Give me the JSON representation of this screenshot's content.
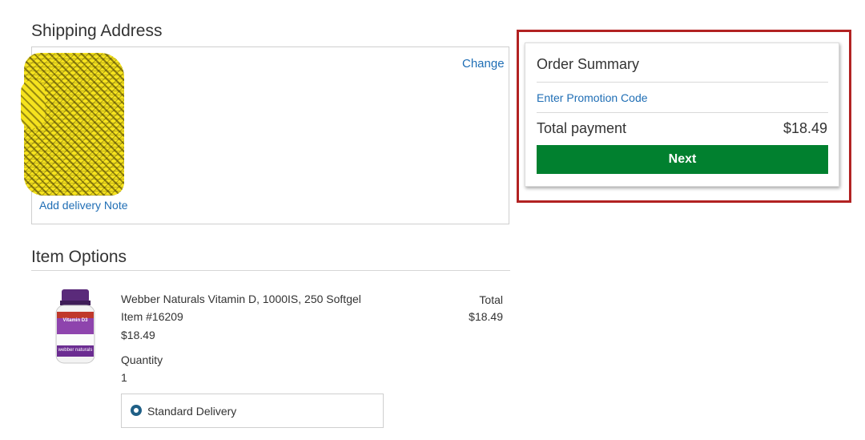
{
  "shipping": {
    "title": "Shipping Address",
    "change_label": "Change",
    "delivery_note_label": "Add delivery Note"
  },
  "item_options": {
    "title": "Item Options",
    "item": {
      "name": "Webber Naturals Vitamin D, 1000IS, 250 Softgel",
      "item_number": "Item #16209",
      "price": "$18.49",
      "quantity_label": "Quantity",
      "quantity": "1",
      "total_label": "Total",
      "total": "$18.49",
      "image_text": {
        "brand": "webber naturals",
        "product": "Vitamin D3"
      }
    },
    "delivery_option": "Standard Delivery"
  },
  "order_summary": {
    "title": "Order Summary",
    "promo_label": "Enter Promotion Code",
    "total_label": "Total payment",
    "total_value": "$18.49",
    "next_label": "Next"
  },
  "colors": {
    "link": "#1f6eb5",
    "next_button": "#01802f",
    "highlight_border": "#b22222",
    "redaction": "#f5e21e"
  }
}
